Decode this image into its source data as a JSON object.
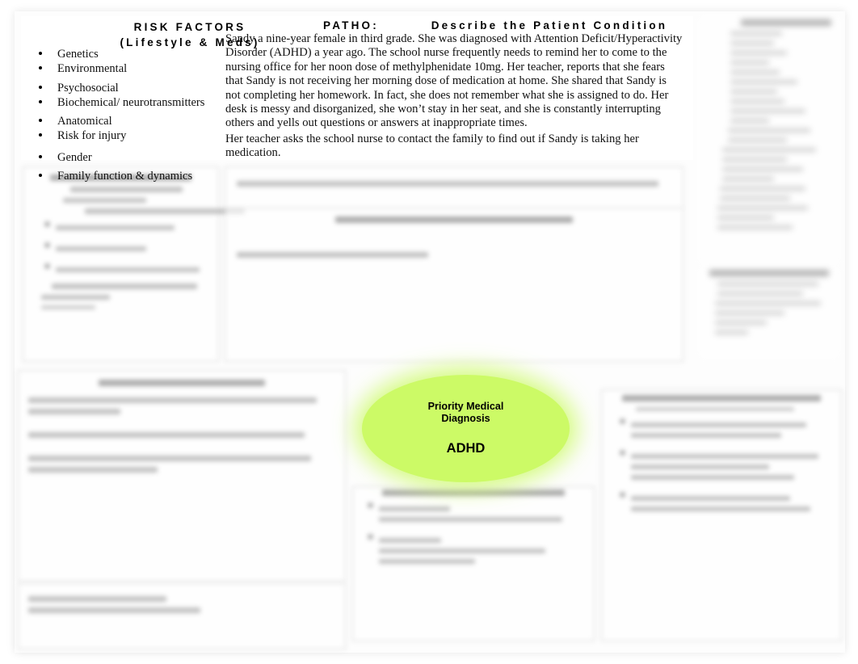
{
  "document": {
    "type": "nursing-concept-map",
    "background_color": "#ffffff"
  },
  "headers": {
    "risk_factors_title": "RISK FACTORS",
    "risk_factors_subtitle": "(Lifestyle & Meds)",
    "patho_label": "PATHO:",
    "patho_title": "Describe the Patient Condition"
  },
  "risk_factors": {
    "items": [
      "Genetics",
      "Environmental",
      "Psychosocial",
      "Biochemical/ neurotransmitters",
      "Anatomical",
      "Risk for injury",
      "Gender",
      "Family function & dynamics"
    ]
  },
  "case_description": {
    "paragraphs": [
      "Sandy a nine-year female in third grade. She was diagnosed with Attention Deficit/Hyperactivity Disorder (ADHD) a year ago. The school nurse frequently needs to remind her to come to the nursing office for her noon dose of methylphenidate 10mg.  Her teacher, reports that she fears that Sandy is not receiving her morning dose of medication at home. She shared that Sandy is not completing her homework. In fact, she does not remember what she is assigned to do. Her desk is messy and disorganized, she won’t stay in her seat, and she is constantly interrupting others and yells out questions or answers at inappropriate times.",
      "Her teacher asks the school nurse to contact the family to find out if Sandy is taking her medication."
    ]
  },
  "diagnosis_oval": {
    "label_line1": "Priority Medical",
    "label_line2": "Diagnosis",
    "value": "ADHD",
    "fill_color": "#ccfa66",
    "glow_color": "#ccfa66"
  },
  "panels": {
    "manifestations": {
      "title": "",
      "legible": false
    },
    "patho_body": {
      "title": "",
      "legible": false
    },
    "patho_note": {
      "title": "",
      "legible": false
    },
    "sidebar_top": {
      "title": "",
      "legible": false
    },
    "sidebar_mid": {
      "title": "",
      "legible": false
    },
    "bottom_left": {
      "title": "",
      "legible": false
    },
    "bottom_left_small": {
      "title": "",
      "legible": false
    },
    "bottom_center": {
      "title": "",
      "legible": false
    },
    "bottom_right": {
      "title": "",
      "legible": false
    }
  }
}
